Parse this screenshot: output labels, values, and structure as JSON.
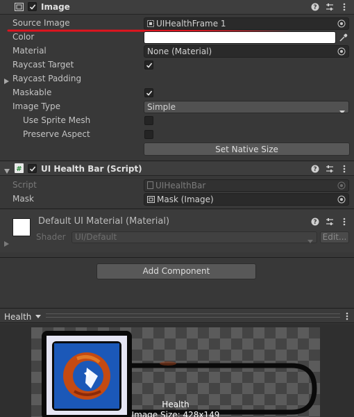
{
  "image_component": {
    "title": "Image",
    "enabled": true,
    "fields": {
      "source_image": {
        "label": "Source Image",
        "value": "UIHealthFrame 1"
      },
      "color": {
        "label": "Color",
        "value": "#ffffff"
      },
      "material": {
        "label": "Material",
        "value": "None (Material)"
      },
      "raycast_target": {
        "label": "Raycast Target",
        "checked": true
      },
      "raycast_padding": {
        "label": "Raycast Padding"
      },
      "maskable": {
        "label": "Maskable",
        "checked": true
      },
      "image_type": {
        "label": "Image Type",
        "value": "Simple"
      },
      "use_sprite_mesh": {
        "label": "Use Sprite Mesh",
        "checked": false
      },
      "preserve_aspect": {
        "label": "Preserve Aspect",
        "checked": false
      }
    },
    "set_native_size_label": "Set Native Size"
  },
  "health_bar_component": {
    "title": "UI Health Bar (Script)",
    "enabled": true,
    "script": {
      "label": "Script",
      "value": "UIHealthBar"
    },
    "mask": {
      "label": "Mask",
      "value": "Mask (Image)"
    }
  },
  "material_component": {
    "title": "Default UI Material (Material)",
    "shader_label": "Shader",
    "shader_value": "UI/Default",
    "edit_label": "Edit..."
  },
  "add_component_label": "Add Component",
  "preview": {
    "dropdown_label": "Health",
    "caption_name": "Health",
    "caption_size": "Image Size: 428x149"
  },
  "colors": {
    "annotation_red": "#e0141e",
    "panel_bg": "#383838",
    "header_bg": "#3e3e3e"
  }
}
